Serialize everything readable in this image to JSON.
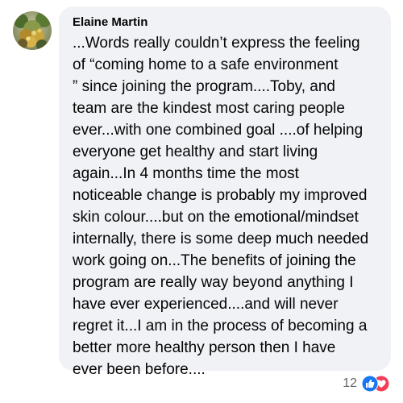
{
  "comment": {
    "author": "Elaine Martin",
    "text": "...Words really couldn’t express the feeling\nof “coming home to a safe environment\n” since joining the program....Toby, and\nteam are the kindest most caring people\never...with one combined goal ....of helping\neveryone get healthy and start living\nagain...In 4 months time   the most\nnoticeable change is probably my improved\nskin colour....but on the emotional/mindset\ninternally, there is some deep much needed\nwork going on...The benefits of joining the\nprogram are really way beyond anything I\nhave ever experienced....and will never\nregret it...I am in the process of becoming a\nbetter more  healthy person then I have\never been before...."
  },
  "reactions": {
    "count": "12",
    "icons": [
      "like-icon",
      "love-icon"
    ],
    "colors": {
      "like": "#1877f2",
      "love": "#f33e58"
    }
  },
  "colors": {
    "bubble_bg": "#f0f2f5",
    "text": "#050505",
    "secondary_text": "#65676b"
  }
}
